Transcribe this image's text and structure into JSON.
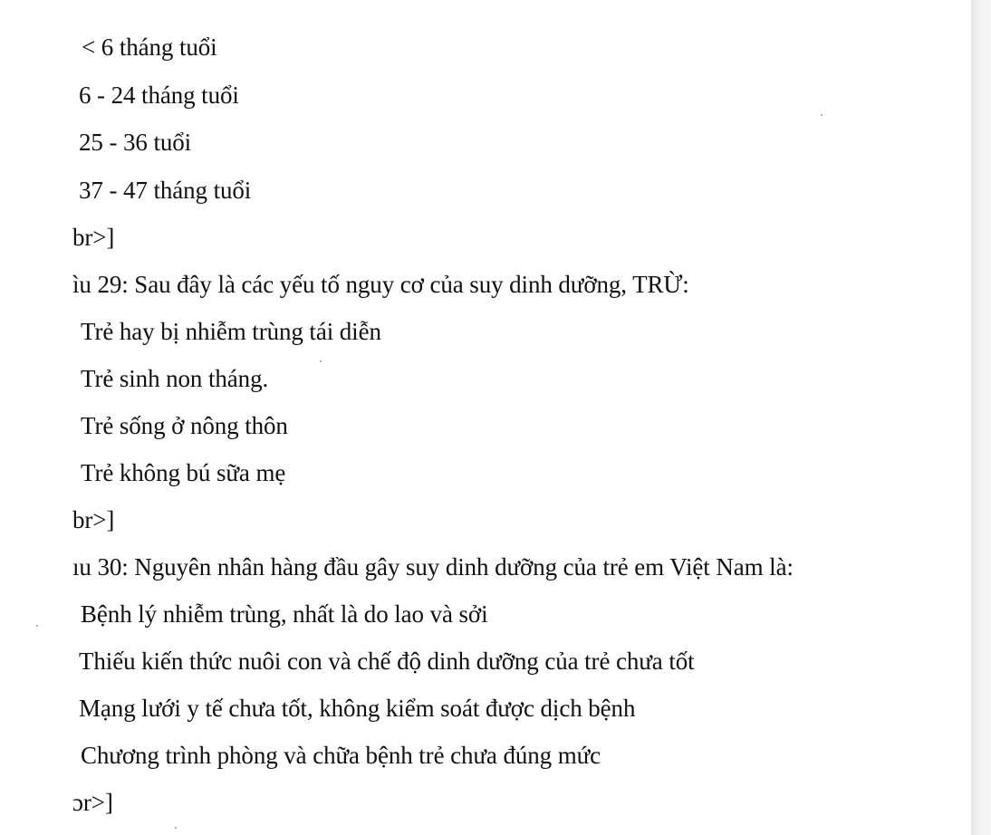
{
  "lines": [
    "< 6 tháng tuổi",
    "6 - 24 tháng tuổi",
    "25 - 36 tuổi",
    "37 - 47 tháng tuổi",
    "br>]",
    "ìu 29: Sau đây là các yếu tố nguy cơ của suy dinh dưỡng, TRỪ:",
    "Trẻ hay bị nhiễm trùng tái diễn",
    "Trẻ sinh non tháng.",
    "Trẻ sống ở nông thôn",
    "Trẻ không bú sữa mẹ",
    "br>]",
    "ıu 30: Nguyên nhân hàng đầu gây suy dinh dưỡng của trẻ em Việt Nam là:",
    "Bệnh lý nhiễm trùng, nhất là do lao và sởi",
    "Thiếu kiến thức nuôi con và chế độ dinh dưỡng của trẻ chưa tốt",
    "Mạng lưới y tế chưa tốt, không kiểm soát được dịch bệnh",
    "Chương trình phòng và chữa bệnh trẻ chưa đúng mức",
    "ɔr>]"
  ]
}
